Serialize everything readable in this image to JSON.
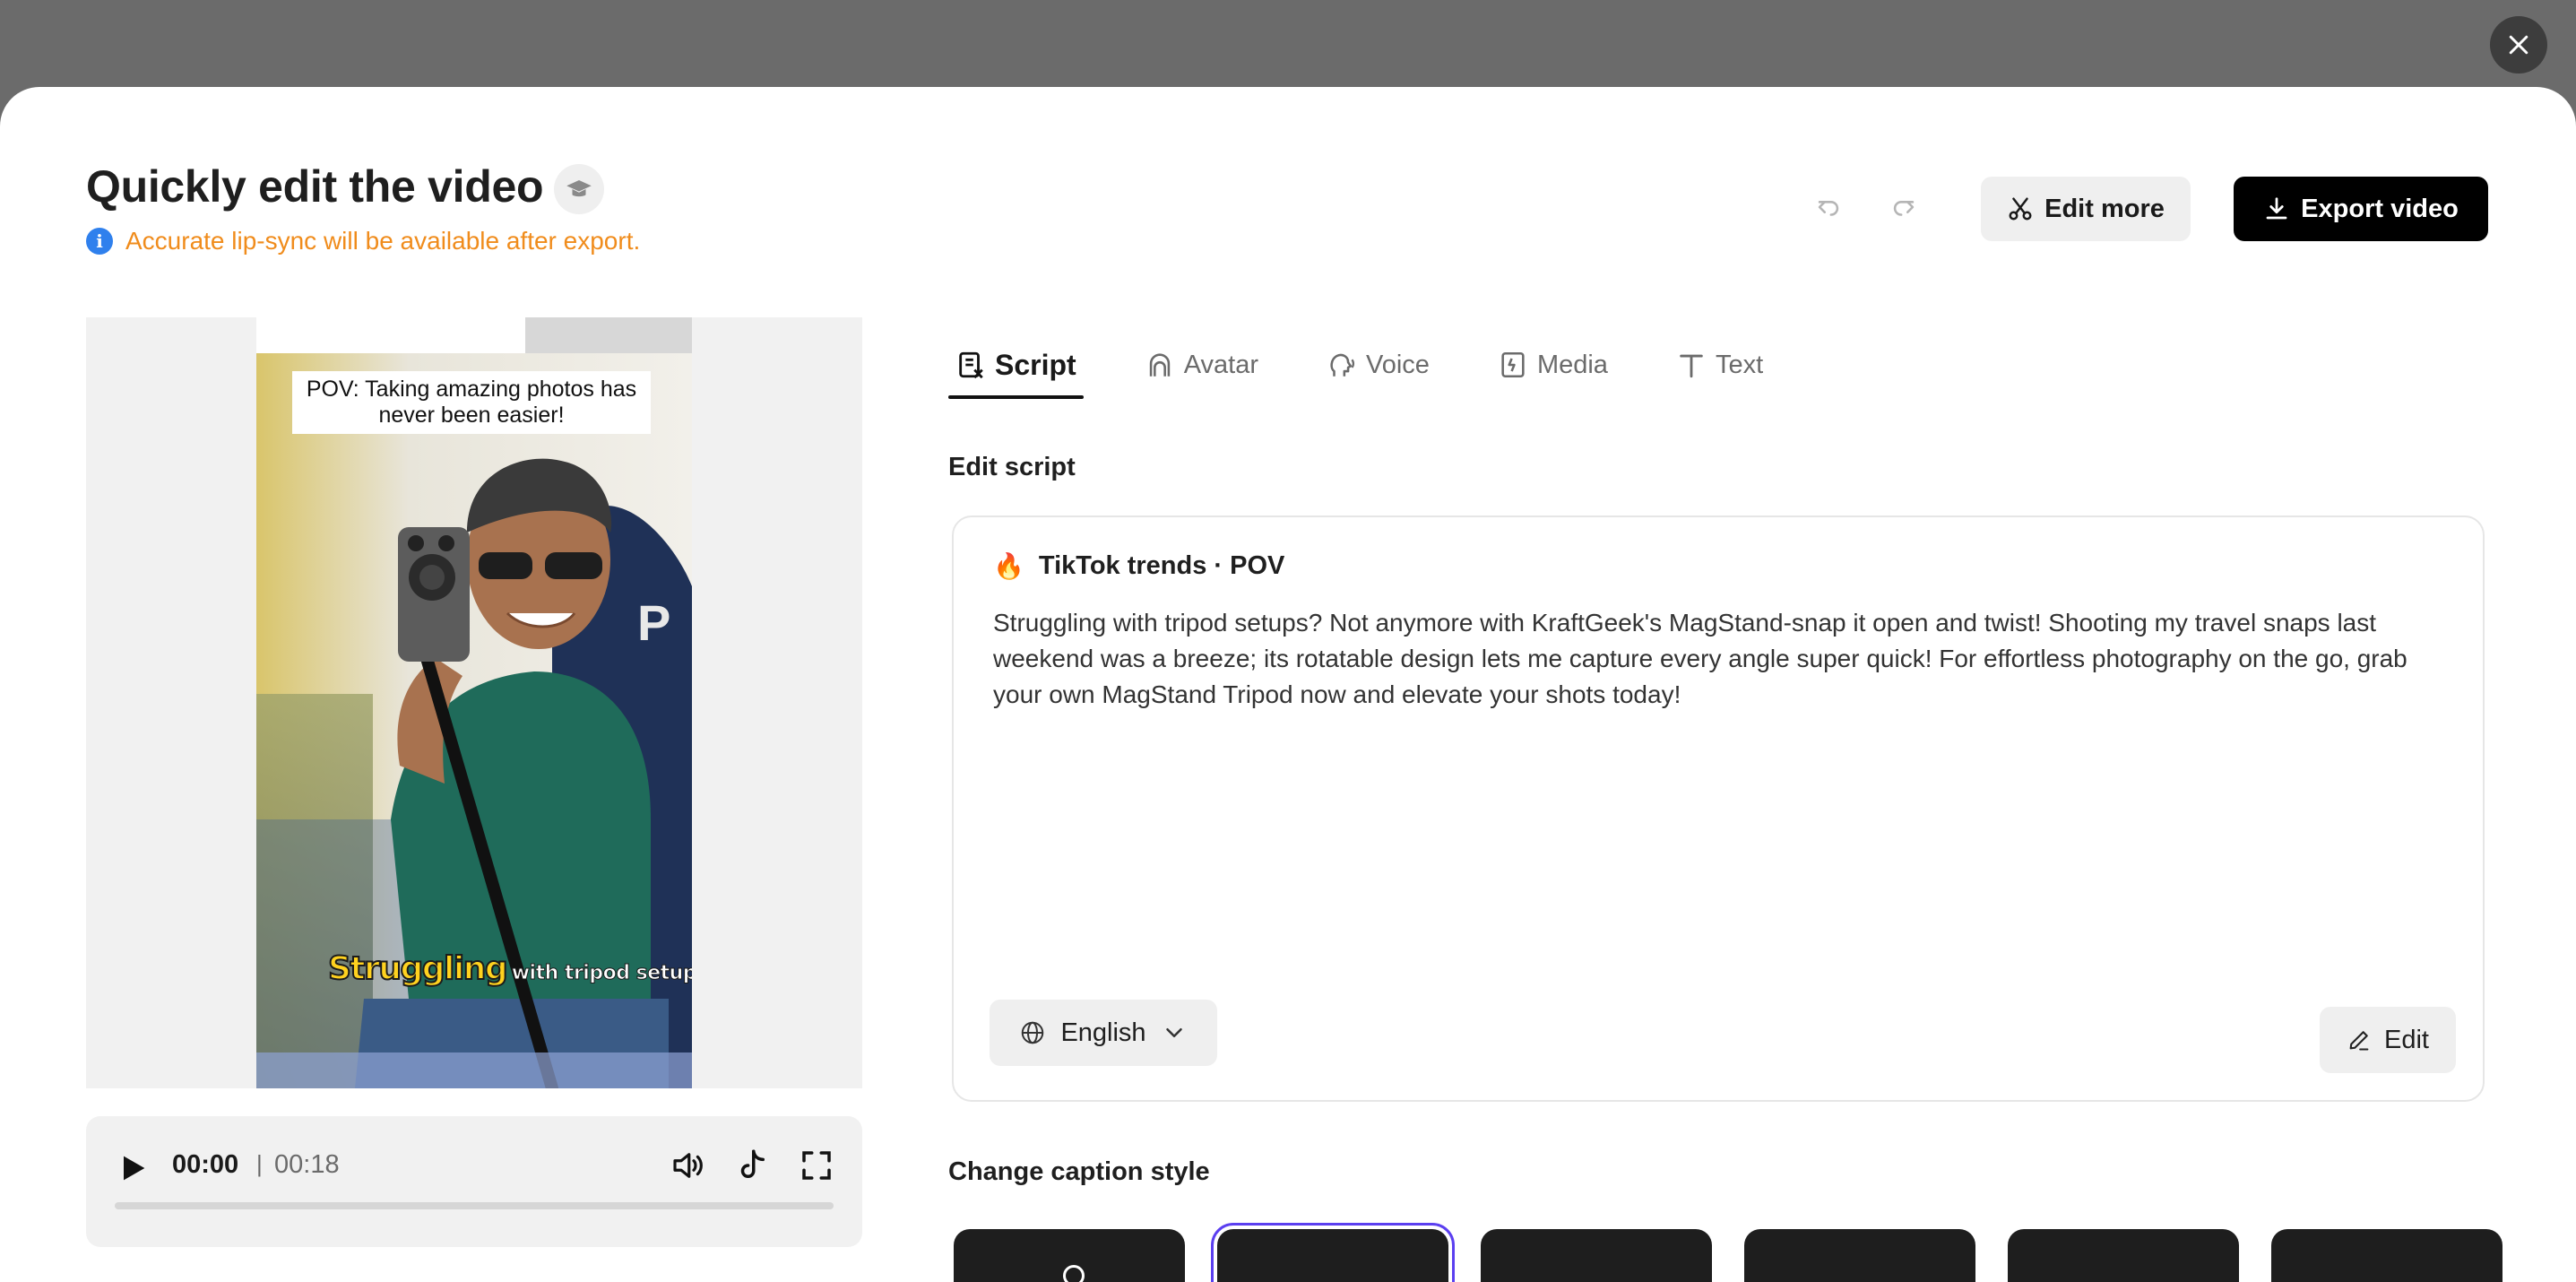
{
  "header": {
    "title": "Quickly edit the video",
    "notice": "Accurate lip-sync will be available after export.",
    "edit_more_label": "Edit more",
    "export_label": "Export video"
  },
  "preview": {
    "caption_top": "POV: Taking amazing photos has never been easier!",
    "caption_bottom_highlight": "Struggling",
    "caption_bottom_rest": "with tripod setups?"
  },
  "player": {
    "current_time": "00:00",
    "separator": "|",
    "total_time": "00:18",
    "progress": 0.0
  },
  "tabs": [
    {
      "label": "Script",
      "icon": "script-icon",
      "active": true
    },
    {
      "label": "Avatar",
      "icon": "avatar-icon",
      "active": false
    },
    {
      "label": "Voice",
      "icon": "voice-icon",
      "active": false
    },
    {
      "label": "Media",
      "icon": "media-icon",
      "active": false
    },
    {
      "label": "Text",
      "icon": "text-icon",
      "active": false
    }
  ],
  "script": {
    "section_label": "Edit script",
    "tag": "TikTok trends · POV",
    "tag_icon": "🔥",
    "body": "Struggling with tripod setups? Not anymore with KraftGeek's MagStand-snap it open and twist! Shooting my travel snaps last weekend was a breeze; its rotatable design lets me capture every angle super quick! For effortless photography on the go, grab your own MagStand Tripod now and elevate your shots today!",
    "language": "English",
    "edit_label": "Edit"
  },
  "caption_style": {
    "section_label": "Change caption style",
    "selected_index": 1,
    "count": 6
  },
  "colors": {
    "accent": "#5b3ff0",
    "notice": "#f08c1c",
    "info": "#2f80ed",
    "primary_button": "#000000"
  }
}
